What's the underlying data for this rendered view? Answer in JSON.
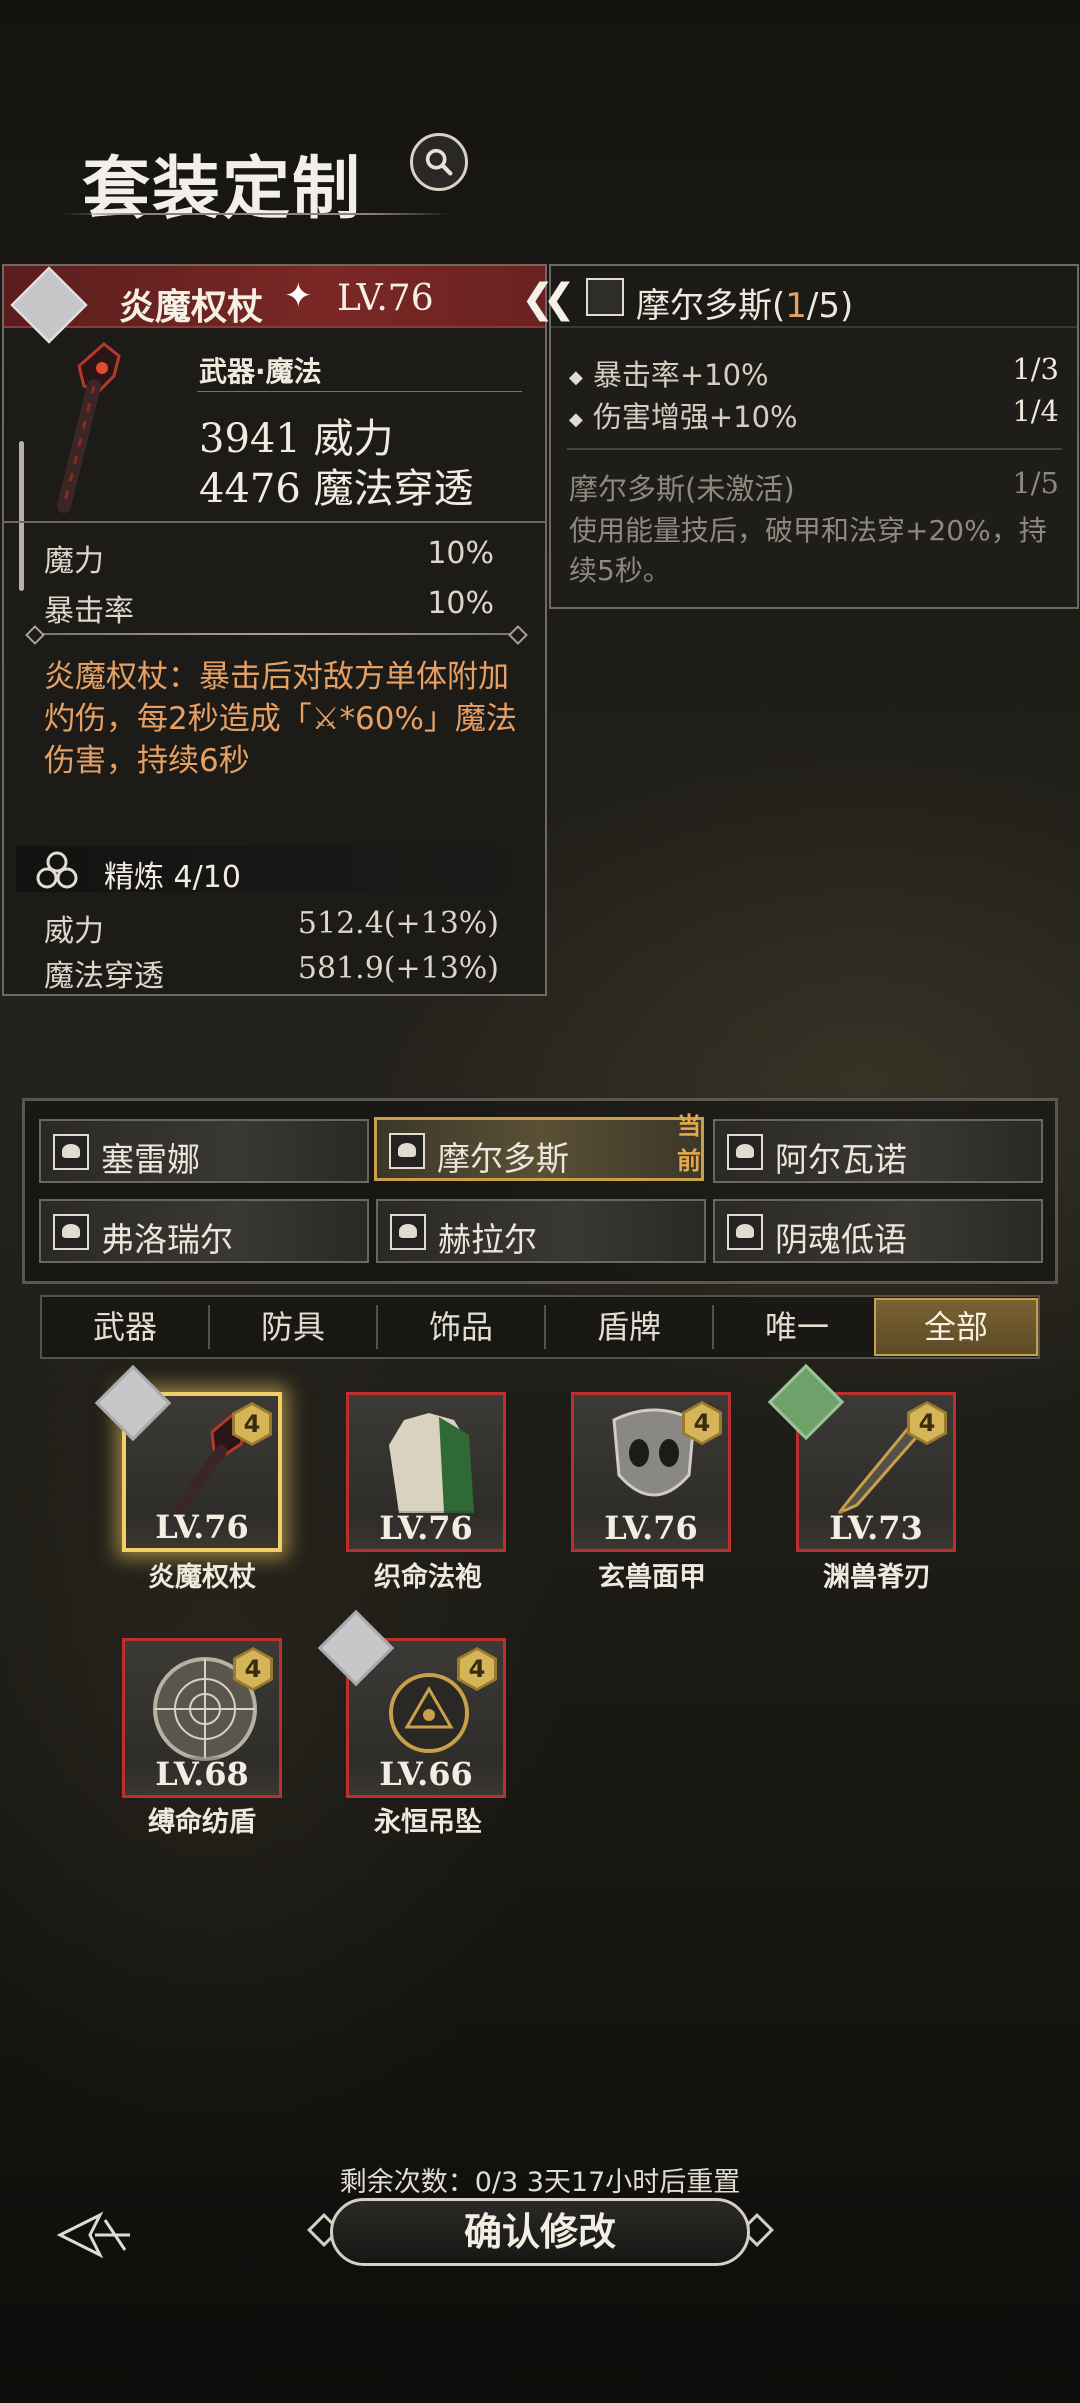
{
  "header": {
    "title": "套装定制",
    "search_icon": "search-icon"
  },
  "item_detail": {
    "name": "炎魔权杖",
    "level": "LV.76",
    "type": "武器·魔法",
    "main_stats": [
      "3941 威力",
      "4476 魔法穿透"
    ],
    "attributes": [
      {
        "label": "魔力",
        "value": "10%"
      },
      {
        "label": "暴击率",
        "value": "10%"
      }
    ],
    "effect_desc": "炎魔权杖：暴击后对敌方单体附加灼伤，每2秒造成「⚔*60%」魔法伤害，持续6秒",
    "refine": {
      "label": "精炼 4/10",
      "stats": [
        {
          "label": "威力",
          "value": "512.4(+13%)"
        },
        {
          "label": "魔法穿透",
          "value": "581.9(+13%)"
        }
      ]
    }
  },
  "set_bonus": {
    "name": "摩尔多斯(",
    "count": "1",
    "total": "/5)",
    "bonuses": [
      {
        "label": "暴击率+10%",
        "value": "1/3"
      },
      {
        "label": "伤害增强+10%",
        "value": "1/4"
      }
    ],
    "inactive_label": "摩尔多斯(未激活)",
    "inactive_value": "1/5",
    "inactive_desc": "使用能量技后，破甲和法穿+20%，持续5秒。"
  },
  "sets": {
    "current_tag": "当前",
    "items": [
      "塞雷娜",
      "摩尔多斯",
      "阿尔瓦诺",
      "弗洛瑞尔",
      "赫拉尔",
      "阴魂低语"
    ]
  },
  "tabs": [
    "武器",
    "防具",
    "饰品",
    "盾牌",
    "唯一",
    "全部"
  ],
  "cards": [
    {
      "name": "炎魔权杖",
      "level": "LV.76",
      "badge": "4"
    },
    {
      "name": "织命法袍",
      "level": "LV.76",
      "badge": ""
    },
    {
      "name": "玄兽面甲",
      "level": "LV.76",
      "badge": "4"
    },
    {
      "name": "渊兽脊刃",
      "level": "LV.73",
      "badge": "4"
    },
    {
      "name": "缚命纺盾",
      "level": "LV.68",
      "badge": "4"
    },
    {
      "name": "永恒吊坠",
      "level": "LV.66",
      "badge": "4"
    }
  ],
  "footer": {
    "remaining": "剩余次数：0/3   3天17小时后重置",
    "confirm_label": "确认修改"
  },
  "colors": {
    "accent_gold": "#c8a04a",
    "rarity_red": "#b9302c",
    "effect_orange": "#e7a064"
  }
}
